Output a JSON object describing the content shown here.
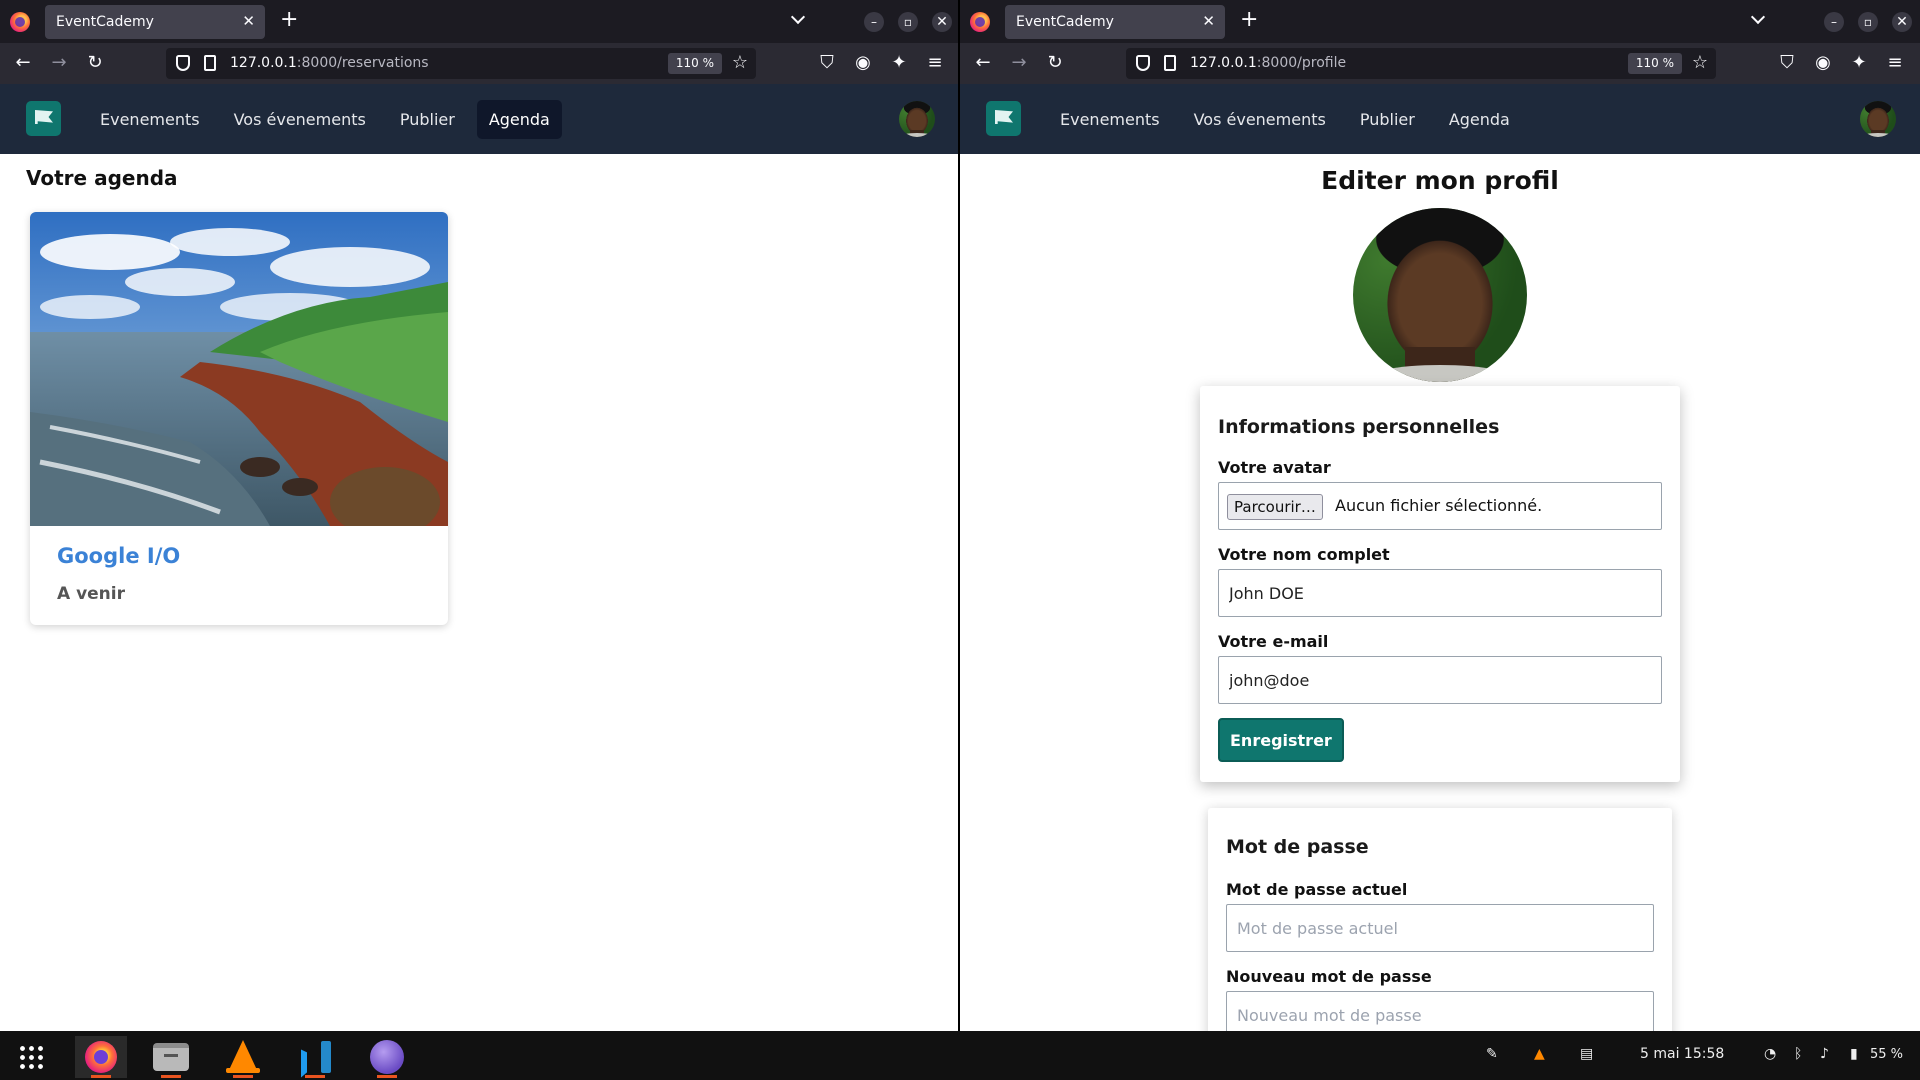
{
  "left_window": {
    "tab_title": "EventCademy",
    "url_host": "127.0.0.1",
    "url_rest": ":8000/reservations",
    "zoom": "110 %",
    "nav": {
      "items": [
        "Evenements",
        "Vos évenements",
        "Publier",
        "Agenda"
      ],
      "active": "Agenda"
    },
    "page_title": "Votre agenda",
    "event_card": {
      "title": "Google I/O",
      "status": "A venir"
    }
  },
  "right_window": {
    "tab_title": "EventCademy",
    "url_host": "127.0.0.1",
    "url_rest": ":8000/profile",
    "zoom": "110 %",
    "nav": {
      "items": [
        "Evenements",
        "Vos évenements",
        "Publier",
        "Agenda"
      ]
    },
    "page_title": "Editer mon profil",
    "personal_info": {
      "heading": "Informations personnelles",
      "avatar_label": "Votre avatar",
      "file_button": "Parcourir…",
      "file_status": "Aucun fichier sélectionné.",
      "name_label": "Votre nom complet",
      "name_value": "John DOE",
      "email_label": "Votre e-mail",
      "email_value": "john@doe",
      "save_button": "Enregistrer"
    },
    "password": {
      "heading": "Mot de passe",
      "current_label": "Mot de passe actuel",
      "current_placeholder": "Mot de passe actuel",
      "new_label": "Nouveau mot de passe",
      "new_placeholder": "Nouveau mot de passe"
    }
  },
  "taskbar": {
    "clock": "5 mai  15:58",
    "battery": "55 %",
    "apps": [
      "firefox-icon",
      "files-icon",
      "vlc-icon",
      "vscode-icon",
      "navigator-icon"
    ]
  },
  "colors": {
    "nav_bg": "#1e293b",
    "brand": "#0f766e",
    "link": "#3b82d6",
    "save": "#0f766e"
  }
}
